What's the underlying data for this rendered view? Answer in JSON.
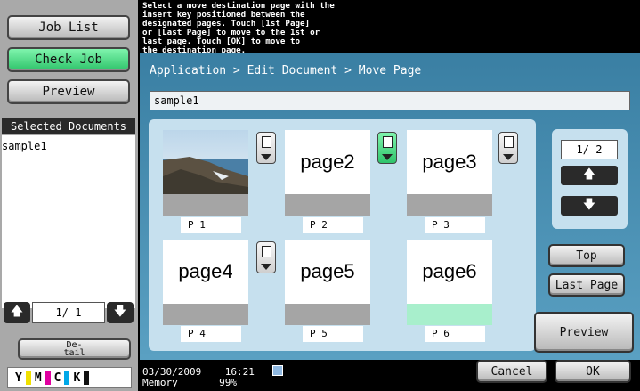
{
  "sidebar": {
    "job_list": "Job List",
    "check_job": "Check Job",
    "preview": "Preview",
    "selected_header": "Selected Documents",
    "selected_items": [
      "sample1"
    ],
    "page_indicator": "1/  1",
    "detail_line1": "De-",
    "detail_line2": "tail",
    "toner": [
      "Y",
      "M",
      "C",
      "K"
    ]
  },
  "message": {
    "lines": [
      "Select a move destination page with the",
      "insert key positioned between the",
      "designated pages. Touch [1st Page]",
      "or [Last Page] to move to the 1st or",
      "last page. Touch [OK] to move to",
      "the destination page."
    ]
  },
  "header": {
    "breadcrumb": "Application > Edit Document > Move Page",
    "document_name": "sample1"
  },
  "pages": [
    {
      "text": "",
      "label": "P   1"
    },
    {
      "text": "page2",
      "label": "P   2"
    },
    {
      "text": "page3",
      "label": "P   3"
    },
    {
      "text": "page4",
      "label": "P   4"
    },
    {
      "text": "page5",
      "label": "P   5"
    },
    {
      "text": "page6",
      "label": "P   6"
    }
  ],
  "pager": {
    "indicator": "1/  2"
  },
  "buttons": {
    "top": "Top",
    "last_page": "Last Page",
    "preview": "Preview",
    "cancel": "Cancel",
    "ok": "OK"
  },
  "status": {
    "date": "03/30/2009",
    "time": "16:21",
    "memory_label": "Memory",
    "memory_value": "99%"
  },
  "colors": {
    "accent_green": "#2fc46b",
    "panel_blue": "#3a7fa3",
    "light_blue": "#c6e0ee"
  }
}
